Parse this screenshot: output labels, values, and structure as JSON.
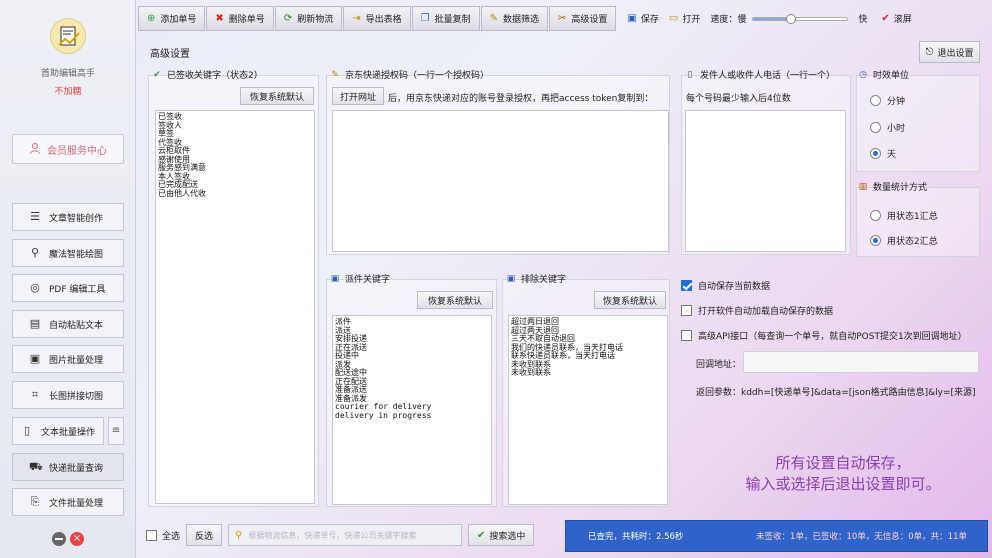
{
  "sidebar": {
    "app_name": "首助编辑高手",
    "app_sub": "不加糖",
    "member_label": "会员服务中心",
    "items": [
      {
        "label": "文章智能创作",
        "icon": "list-icon"
      },
      {
        "label": "魔法智能绘图",
        "icon": "magic-wand-icon"
      },
      {
        "label": "PDF 编辑工具",
        "icon": "pdf-icon"
      },
      {
        "label": "自动粘贴文本",
        "icon": "paste-icon"
      },
      {
        "label": "图片批量处理",
        "icon": "image-icon"
      },
      {
        "label": "长图拼接切图",
        "icon": "crop-icon"
      },
      {
        "label": "文本批量操作",
        "icon": "text-icon"
      },
      {
        "label": "快递批量查询",
        "icon": "truck-icon"
      },
      {
        "label": "文件批量处理",
        "icon": "file-icon"
      }
    ]
  },
  "toolbar": {
    "add": "添加单号",
    "delete": "删除单号",
    "refresh": "刷新物流",
    "export": "导出表格",
    "batch_copy": "批量复制",
    "filter": "数据筛选",
    "advanced": "高级设置",
    "save": "保存",
    "open": "打开",
    "speed_label": "速度：慢",
    "speed_fast": "快",
    "speed_value": 0.4,
    "scroll": "滚屏"
  },
  "settings": {
    "title": "高级设置",
    "exit": "退出设置",
    "signed_keywords": {
      "label": "已签收关键字（状态2）",
      "restore": "恢复系统默认",
      "content": "已签收\n签收人\n草签\n代签收\n云柜取件\n感谢使用\n服务感到满意\n本人签收\n已完成配送\n已由他人代收"
    },
    "jd_token": {
      "label": "京东快递授权码（一行一个授权码）",
      "open_url": "打开网址",
      "hint": "后，用京东快递对应的账号登录授权，再把access token复制到："
    },
    "phone": {
      "label": "发件人或收件人电话（一行一个）",
      "hint": "每个号码最少输入后4位数"
    },
    "timeout_unit": {
      "label": "时效单位",
      "options": [
        "分钟",
        "小时",
        "天"
      ],
      "selected": "天"
    },
    "stats_method": {
      "label": "数量统计方式",
      "options": [
        "用状态1汇总",
        "用状态2汇总"
      ],
      "selected": "用状态2汇总"
    },
    "delivery_keywords": {
      "label": "派件关键字",
      "restore": "恢复系统默认",
      "content": "派件\n派送\n安排投递\n正在派送\n投递中\n派发\n配送途中\n正在配送\n准备派送\n准备派发\ncourier for delivery\ndelivery in progress"
    },
    "exclude_keywords": {
      "label": "排除关键字",
      "restore": "恢复系统默认",
      "content": "超过两日退回\n超过两天退回\n三天不取自动退回\n我们的快递员联系，当天打电话\n联系快递员联系，当天打电话\n未收到联系\n未收到联系"
    },
    "checks": {
      "autosave": "自动保存当前数据",
      "autoload": "打开软件自动加载自动保存的数据",
      "api": "高级API接口（每查询一个单号，就自动POST提交1次到回调地址）"
    },
    "callback_label": "回调地址：",
    "return_params": "返回参数：kddh=[快递单号]&data=[json格式路由信息]&ly=[来源]",
    "note_line1": "所有设置自动保存，",
    "note_line2": "输入或选择后退出设置即可。"
  },
  "bottom": {
    "select_all": "全选",
    "invert": "反选",
    "search_placeholder": "根据物流信息、快递单号、快递公司关键字搜索",
    "search_selected": "搜索选中"
  },
  "status": {
    "left": "已查完，共耗时：2.56秒",
    "right": "未签收：1单，已签收：10单，无信息：0单，共：11单"
  },
  "colors": {
    "accent": "#2f63c9",
    "note": "#8b3fb0",
    "member": "#d46a7a"
  }
}
